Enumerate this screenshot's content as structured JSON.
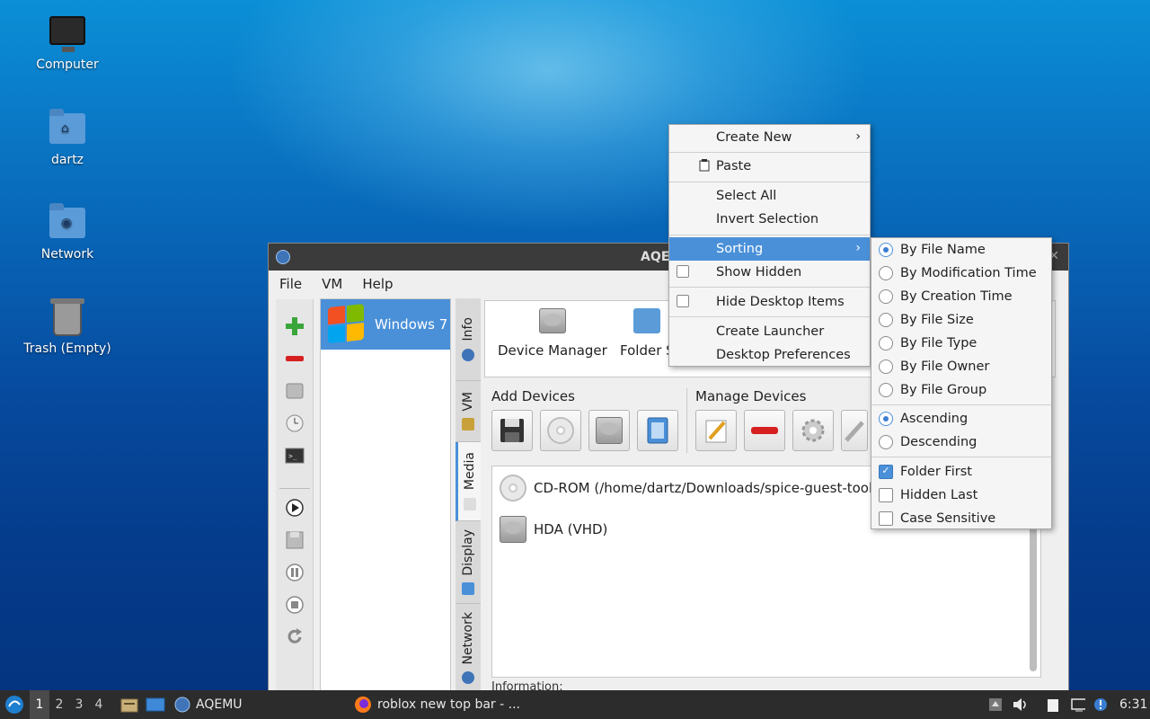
{
  "desktop": {
    "icons": [
      {
        "label": "Computer"
      },
      {
        "label": "dartz"
      },
      {
        "label": "Network"
      },
      {
        "label": "Trash (Empty)"
      }
    ]
  },
  "window": {
    "title": "AQE",
    "menu": [
      "File",
      "VM",
      "Help"
    ],
    "vm_list": [
      {
        "name": "Windows 7"
      }
    ],
    "tabs": [
      "Info",
      "VM",
      "Media",
      "Display",
      "Network"
    ],
    "top_panel": {
      "device_manager": "Device Manager",
      "folder_sharing": "Folder S"
    },
    "add_devices_label": "Add Devices",
    "manage_devices_label": "Manage Devices",
    "devices": [
      {
        "label": "CD-ROM (/home/dartz/Downloads/spice-guest-tools-0.1"
      },
      {
        "label": "HDA (VHD)"
      }
    ],
    "information_label": "Information:"
  },
  "context_menu": {
    "items": {
      "create_new": "Create New",
      "paste": "Paste",
      "select_all": "Select All",
      "invert_selection": "Invert Selection",
      "sorting": "Sorting",
      "show_hidden": "Show Hidden",
      "hide_desktop_items": "Hide Desktop Items",
      "create_launcher": "Create Launcher",
      "desktop_preferences": "Desktop Preferences"
    },
    "sorting_submenu": {
      "by_file_name": "By File Name",
      "by_modification_time": "By Modification Time",
      "by_creation_time": "By Creation Time",
      "by_file_size": "By File Size",
      "by_file_type": "By File Type",
      "by_file_owner": "By File Owner",
      "by_file_group": "By File Group",
      "ascending": "Ascending",
      "descending": "Descending",
      "folder_first": "Folder First",
      "hidden_last": "Hidden Last",
      "case_sensitive": "Case Sensitive"
    }
  },
  "taskbar": {
    "workspaces": [
      "1",
      "2",
      "3",
      "4"
    ],
    "tasks": [
      "AQEMU",
      "roblox new top bar - ..."
    ],
    "clock": "6:31"
  },
  "colors": {
    "accent": "#4a90d9",
    "taskbar": "#2c2c2c",
    "menu_bg": "#f5f5f5"
  }
}
